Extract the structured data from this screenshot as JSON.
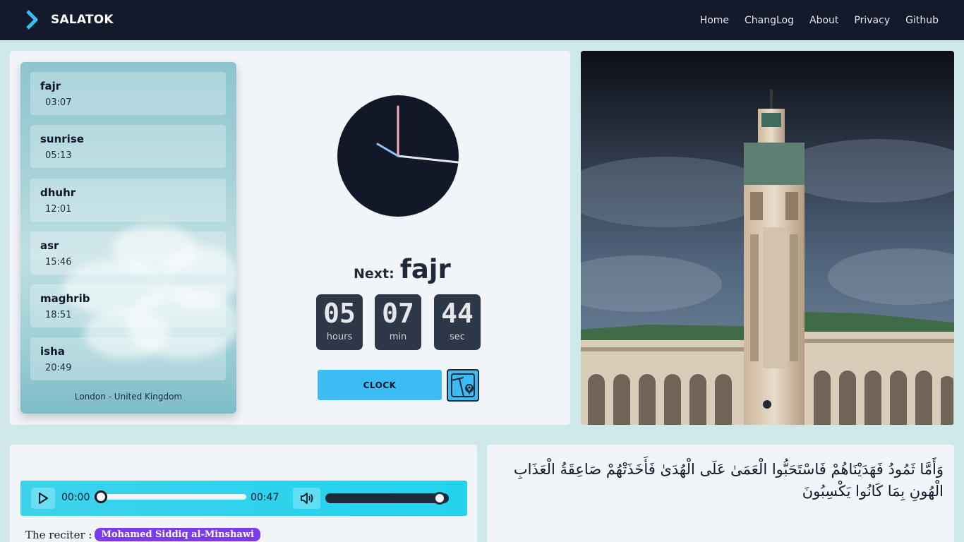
{
  "header": {
    "brand": "SALATOK",
    "nav": [
      "Home",
      "ChangLog",
      "About",
      "Privacy",
      "Github"
    ]
  },
  "prayers": [
    {
      "name": "fajr",
      "time": "03:07"
    },
    {
      "name": "sunrise",
      "time": "05:13"
    },
    {
      "name": "dhuhr",
      "time": "12:01"
    },
    {
      "name": "asr",
      "time": "15:46"
    },
    {
      "name": "maghrib",
      "time": "18:51"
    },
    {
      "name": "isha",
      "time": "20:49"
    }
  ],
  "location": "London - United Kingdom",
  "next": {
    "label": "Next:",
    "name": "fajr"
  },
  "countdown": [
    {
      "value": "05",
      "unit": "hours"
    },
    {
      "value": "07",
      "unit": "min"
    },
    {
      "value": "44",
      "unit": "sec"
    }
  ],
  "buttons": {
    "clock": "CLOCK",
    "map_icon": "map-pin-icon"
  },
  "player": {
    "current_time": "00:00",
    "duration": "00:47",
    "progress": 0,
    "volume": 1
  },
  "reciter": {
    "label": "The reciter :",
    "name": "Mohamed Siddiq al-Minshawi"
  },
  "verse": "وَأَمَّا ثَمُودُ فَهَدَيْنَاهُمْ فَاسْتَحَبُّوا الْعَمَىٰ عَلَى الْهُدَىٰ فَأَخَذَتْهُمْ صَاعِقَةُ الْعَذَابِ الْهُونِ بِمَا كَانُوا يَكْسِبُونَ",
  "colors": {
    "topbar": "#121a2c",
    "accent": "#3cbcf4",
    "player": "#22d3ee",
    "badge": "#7c3aed",
    "countdown_box": "#2d3748"
  }
}
